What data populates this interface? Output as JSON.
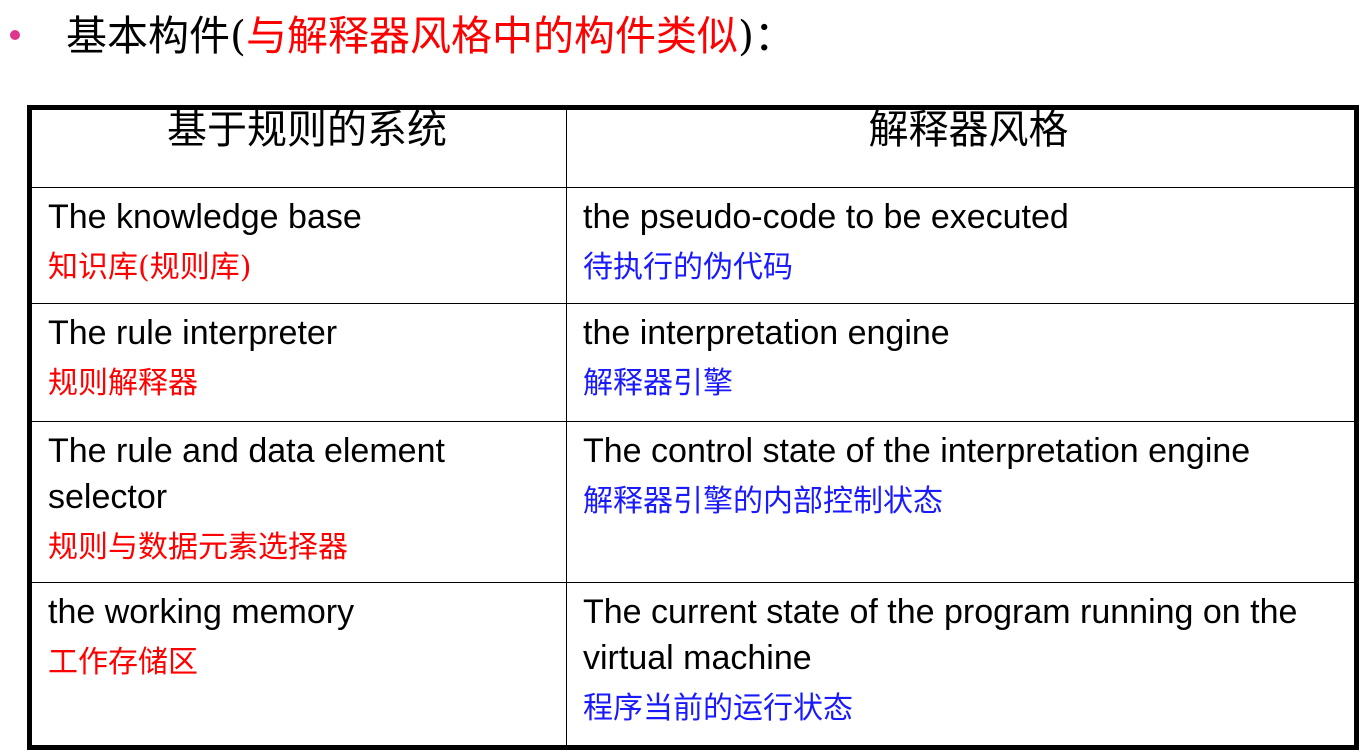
{
  "title": {
    "prefix": "基本构件(",
    "highlight": "与解释器风格中的构件类似",
    "suffix": ")："
  },
  "colors": {
    "bullet": "#e0358d",
    "red_text": "#ff0000",
    "blue_text": "#1a1aff"
  },
  "table": {
    "headers": [
      "基于规则的系统",
      "解释器风格"
    ],
    "rows": [
      {
        "left_en": "The knowledge base",
        "left_zh": "知识库(规则库)",
        "right_en": "the pseudo-code to be executed",
        "right_zh": "待执行的伪代码"
      },
      {
        "left_en": "The rule interpreter",
        "left_zh": "规则解释器",
        "right_en": "the interpretation engine",
        "right_zh": "解释器引擎"
      },
      {
        "left_en": "The rule and data element selector",
        "left_zh": "规则与数据元素选择器",
        "right_en": "The control state of the interpretation engine",
        "right_zh": "解释器引擎的内部控制状态"
      },
      {
        "left_en": "the working memory",
        "left_zh": "工作存储区",
        "right_en": "The current state of the program running on the virtual machine",
        "right_zh": "程序当前的运行状态"
      }
    ]
  }
}
